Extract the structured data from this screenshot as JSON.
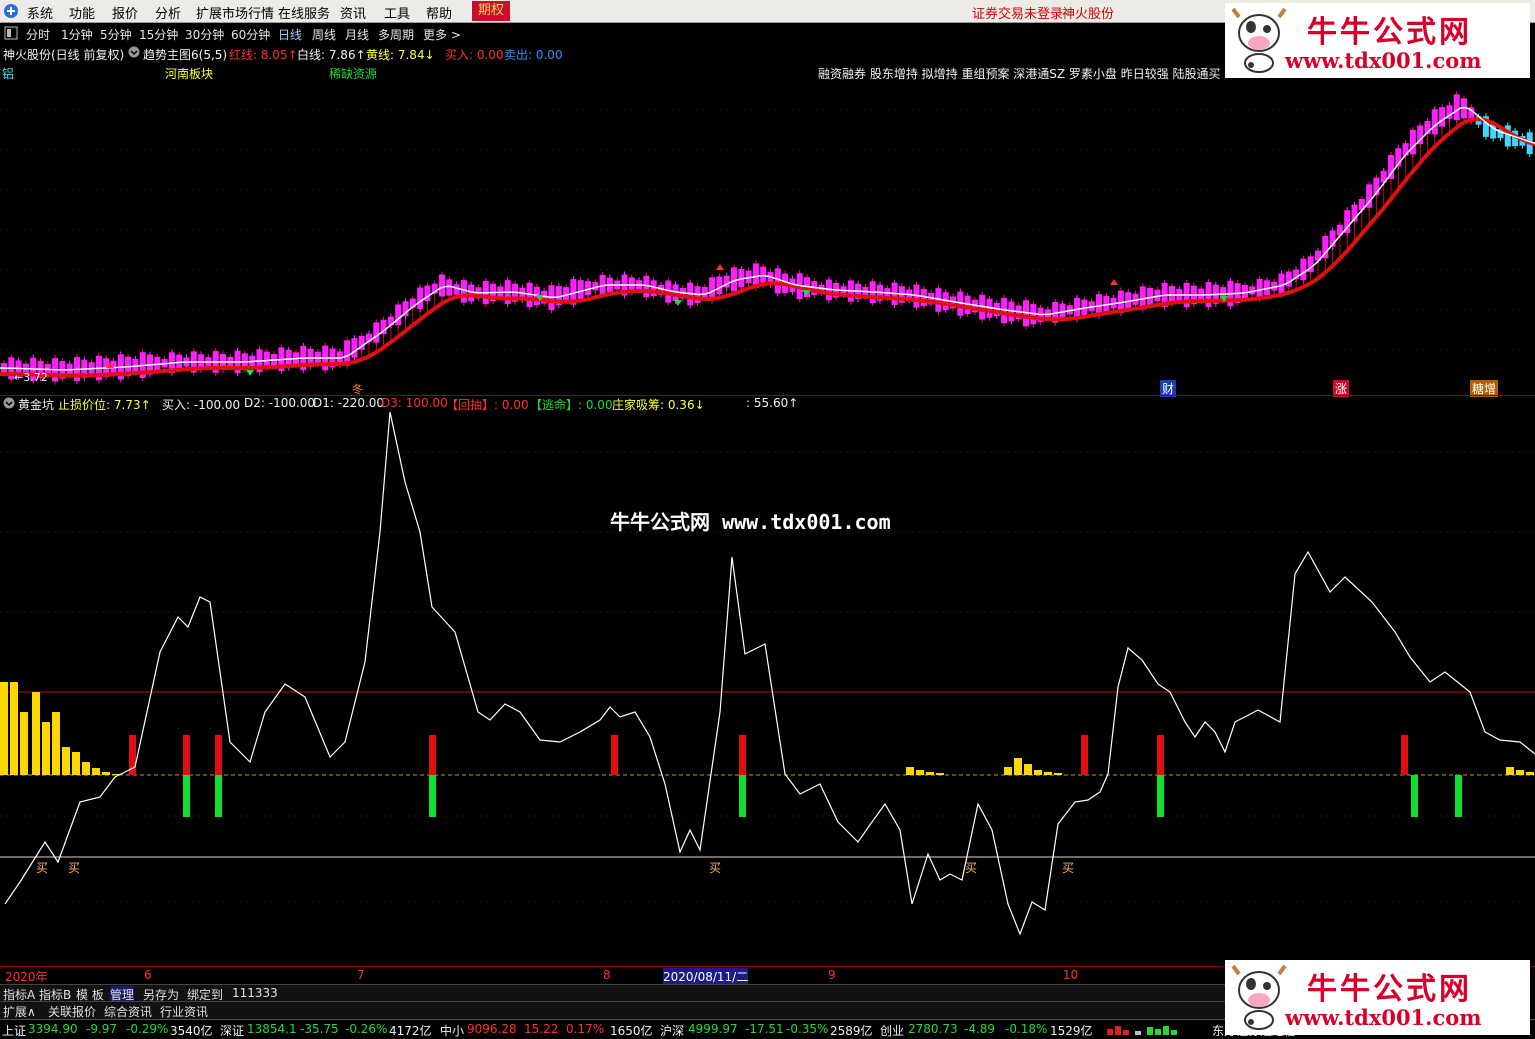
{
  "menu": {
    "items": [
      "系统",
      "功能",
      "报价",
      "分析",
      "扩展市场行情",
      "在线服务",
      "资讯",
      "工具",
      "帮助"
    ],
    "active_item": "期权",
    "status_text": "证券交易未登录",
    "stock_name": "神火股份"
  },
  "toolbar": {
    "periods": [
      "分时",
      "1分钟",
      "5分钟",
      "15分钟",
      "30分钟",
      "60分钟",
      "日线",
      "周线",
      "月线",
      "多周期",
      "更多 >"
    ],
    "selected": "日线"
  },
  "main_chart": {
    "title": "神火股份(日线 前复权)",
    "indicator": "趋势主图6(5,5)",
    "red_line": "红线: 8.05↑",
    "white_line": "白线: 7.86↑",
    "yellow_line": "黄线: 7.84↓",
    "buy": "买入: 0.00",
    "sell": "卖出: 0.00",
    "concepts_left": [
      "铝",
      "河南板块",
      "稀缺资源"
    ],
    "concepts_right": "融资融券 股东增持 拟增持 重组预案 深港通SZ 罗素小盘 昨日较强 陆股通买",
    "low_price_label": "←3.72",
    "event_markers": [
      "财",
      "涨",
      "糖增"
    ],
    "mid_marker": "冬"
  },
  "sub_chart": {
    "name": "黄金坑",
    "stop_loss": "止损价位: 7.73↑",
    "buy": "买入: -100.00",
    "d2": "D2: -100.00",
    "d1": "D1: -220.00",
    "d3": "D3: 100.00",
    "huichou": "【回抽】: 0.00",
    "taoming": "【逃命】: 0.00",
    "zhuangjia": "庄家吸筹: 0.36↓",
    "last": ": 55.60↑",
    "buy_mark": "买"
  },
  "watermark": "牛牛公式网 www.tdx001.com",
  "logo": {
    "title": "牛牛公式网",
    "url": "www.tdx001.com"
  },
  "time_axis": {
    "labels": [
      "2020年",
      "6",
      "7",
      "8",
      "2020/08/11/二",
      "9",
      "10"
    ]
  },
  "tabs_row1": [
    "指标A",
    "指标B",
    "模 板",
    "管理",
    "另存为",
    "绑定到",
    "111333"
  ],
  "tabs_row2": [
    "扩展∧",
    "关联报价",
    "综合资讯",
    "行业资讯"
  ],
  "status_bar": [
    {
      "name": "上证",
      "price": "3394.90",
      "chg": "-9.97",
      "pct": "-0.29%",
      "vol": "3540亿"
    },
    {
      "name": "深证",
      "price": "13854.1",
      "chg": "-35.75",
      "pct": "-0.26%",
      "vol": "4172亿"
    },
    {
      "name": "中小",
      "price": "9096.28",
      "chg": "15.22",
      "pct": "0.17%",
      "vol": "1650亿"
    },
    {
      "name": "沪深",
      "price": "4999.97",
      "chg": "-17.51",
      "pct": "-0.35%",
      "vol": "2589亿"
    },
    {
      "name": "创业",
      "price": "2780.73",
      "chg": "-4.89",
      "pct": "-0.18%",
      "vol": "1529亿"
    }
  ],
  "status_tail": "东方证券通达信"
}
